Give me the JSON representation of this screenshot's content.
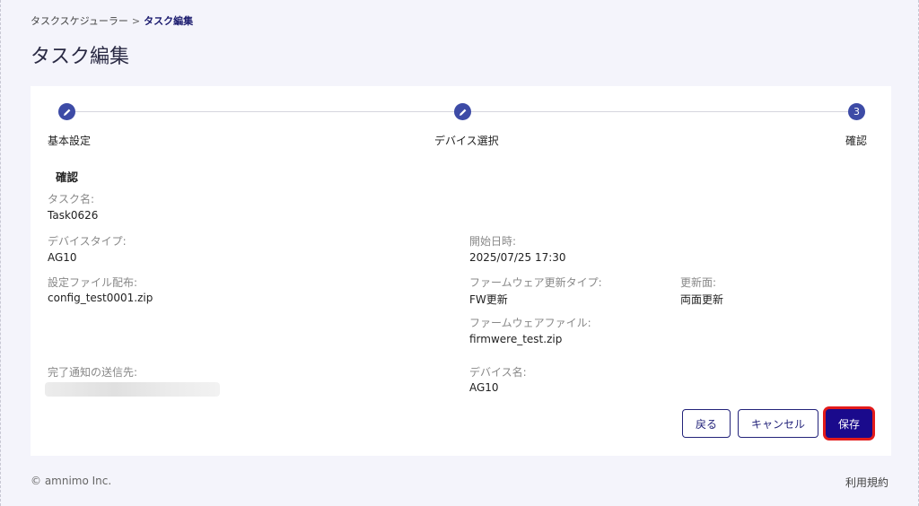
{
  "breadcrumb": {
    "parent": "タスクスケジューラー",
    "separator": ">",
    "current": "タスク編集"
  },
  "page_title": "タスク編集",
  "stepper": {
    "steps": [
      {
        "label": "基本設定",
        "state": "done",
        "icon": "pencil-icon"
      },
      {
        "label": "デバイス選択",
        "state": "done",
        "icon": "pencil-icon"
      },
      {
        "label": "確認",
        "state": "active",
        "number": "3"
      }
    ],
    "color": "#3d4ba6"
  },
  "confirm": {
    "section_title": "確認",
    "task_name_label": "タスク名:",
    "task_name_value": "Task0626",
    "device_type_label": "デバイスタイプ:",
    "device_type_value": "AG10",
    "start_datetime_label": "開始日時:",
    "start_datetime_value": "2025/07/25 17:30",
    "config_file_label": "設定ファイル配布:",
    "config_file_value": "config_test0001.zip",
    "fw_update_type_label": "ファームウェア更新タイプ:",
    "fw_update_type_value": "FW更新",
    "update_side_label": "更新面:",
    "update_side_value": "両面更新",
    "fw_file_label": "ファームウェアファイル:",
    "fw_file_value": "firmwere_test.zip",
    "notify_label": "完了通知の送信先:",
    "device_name_label": "デバイス名:",
    "device_name_value": "AG10"
  },
  "buttons": {
    "back": "戻る",
    "cancel": "キャンセル",
    "save": "保存"
  },
  "colors": {
    "primary": "#1a0a8c",
    "highlight": "#e31b1b"
  },
  "footer": {
    "copyright": "© amnimo Inc.",
    "terms": "利用規約"
  }
}
